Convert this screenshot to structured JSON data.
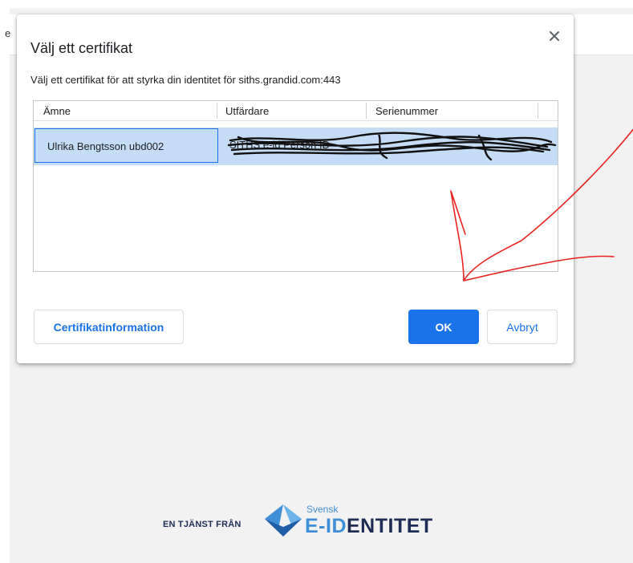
{
  "page": {
    "edge_letter": "e"
  },
  "dialog": {
    "title": "Välj ett certifikat",
    "description": "Välj ett certifikat för att styrka din identitet för siths.grandid.com:443",
    "close_icon": "close-icon",
    "table": {
      "columns": [
        "Ämne",
        "Utfärdare",
        "Serienummer"
      ],
      "rows": [
        {
          "subject": "Ulrika Bengtsson ubd002",
          "issuer": "SITHS e-id Person ID",
          "serial": ""
        }
      ]
    },
    "buttons": {
      "info": "Certifikatinformation",
      "ok": "OK",
      "cancel": "Avbryt"
    }
  },
  "footer": {
    "tagline": "EN TJÄNST FRÅN",
    "logo_small": "Svensk",
    "logo_main_accent": "E-ID",
    "logo_main_rest": "ENTITET"
  },
  "colors": {
    "accent": "#1a73e8",
    "selected_row": "#c4dcf6",
    "annotation": "#e8231e",
    "brand_dark": "#1e2d56",
    "brand_light": "#3f8fd8"
  }
}
